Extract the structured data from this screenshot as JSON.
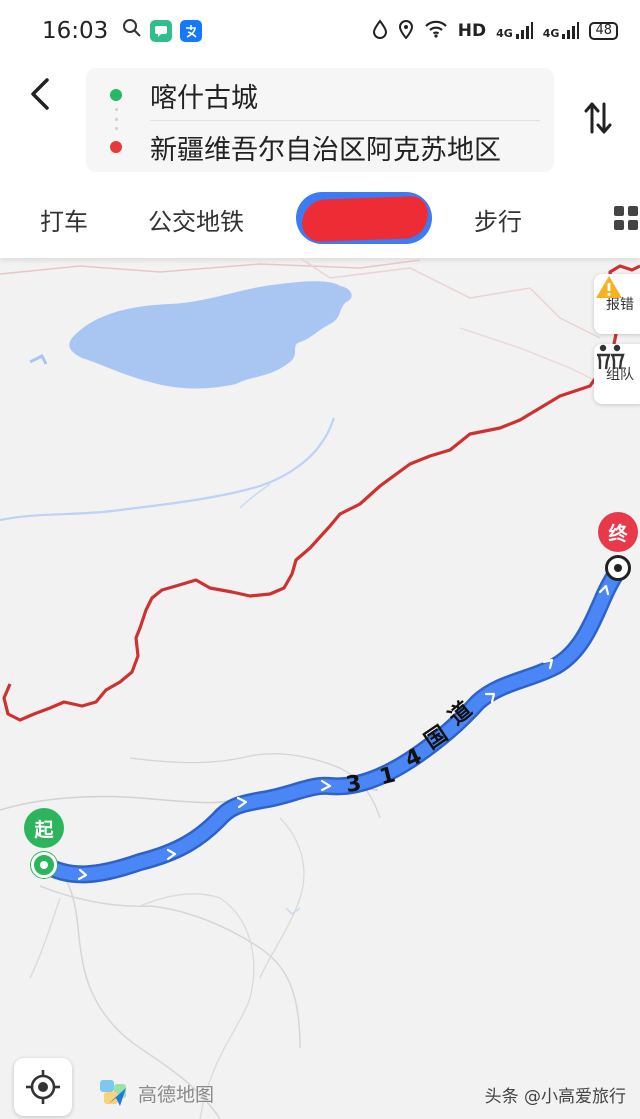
{
  "status_bar": {
    "time": "16:03",
    "network_label": "HD",
    "signal_1": "4G",
    "signal_2": "4G",
    "battery": "48",
    "icons": [
      "search-icon",
      "message-app-icon",
      "alipay-app-icon",
      "water-drop-icon",
      "location-pin-icon",
      "wifi-icon"
    ]
  },
  "route": {
    "origin": "喀什古城",
    "destination": "新疆维吾尔自治区阿克苏地区"
  },
  "tabs": [
    {
      "label": "打车"
    },
    {
      "label": "公交地铁"
    },
    {
      "label": ""
    },
    {
      "label": "步行"
    }
  ],
  "map": {
    "road_name": [
      "3",
      "1",
      "4",
      "国",
      "道"
    ],
    "start_marker": "起",
    "end_marker": "终",
    "report_label": "报错",
    "team_label": "组队",
    "route_color": "#4a86f5",
    "border_color": "#d0302d",
    "lake_color": "#a9c6f3"
  },
  "brand": {
    "name": "高德地图"
  },
  "watermark": "头条 @小高爱旅行"
}
